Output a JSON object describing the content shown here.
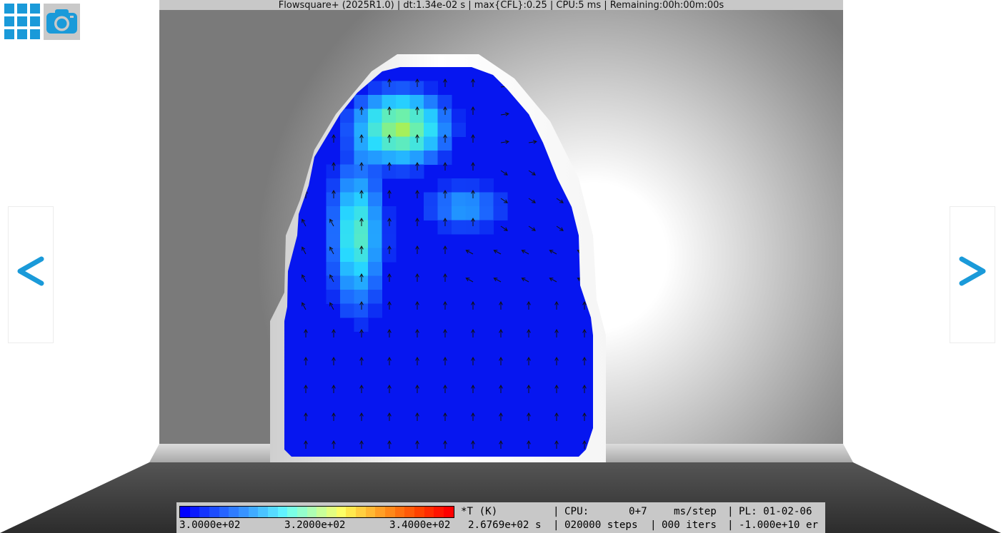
{
  "title_bar": {
    "text": "Flowsquare+ (2025R1.0) | dt:1.34e-02 s | max{CFL}:0.25 | CPU:5 ms | Remaining:00h:00m:00s"
  },
  "toolbar": {
    "menu_icon": "grid-menu-icon",
    "camera_icon": "camera-icon"
  },
  "navigation": {
    "prev_label": "<",
    "next_label": ">"
  },
  "colorbar": {
    "variable": "*T (K)",
    "ticks": [
      "3.0000e+02",
      "3.2000e+02",
      "3.4000e+02"
    ],
    "colors": [
      "#0000ff",
      "#0a1aff",
      "#1334ff",
      "#1c4cff",
      "#2664ff",
      "#2f7cff",
      "#3893ff",
      "#40abff",
      "#4ac3ff",
      "#56dbff",
      "#61f2ff",
      "#7affe6",
      "#94ffcc",
      "#aeffb3",
      "#c9ff99",
      "#e3ff80",
      "#fdff66",
      "#ffe84d",
      "#ffcf40",
      "#ffb833",
      "#ff9f26",
      "#ff8819",
      "#ff700f",
      "#ff5a08",
      "#ff4200",
      "#ff2b00",
      "#ff1400",
      "#ff0000"
    ]
  },
  "status": {
    "time": "2.6769e+02 s",
    "cpu_label": "CPU:",
    "cpu_value": "0+7",
    "cpu_unit": "ms/step",
    "steps": "020000 steps",
    "iters": "000 iters",
    "pl": "PL: 01-02-06",
    "err": "-1.000e+10 er"
  },
  "colors": {
    "accent": "#1a9ad9",
    "panel": "#c8c8c8",
    "floor": "#4a4a4a"
  }
}
